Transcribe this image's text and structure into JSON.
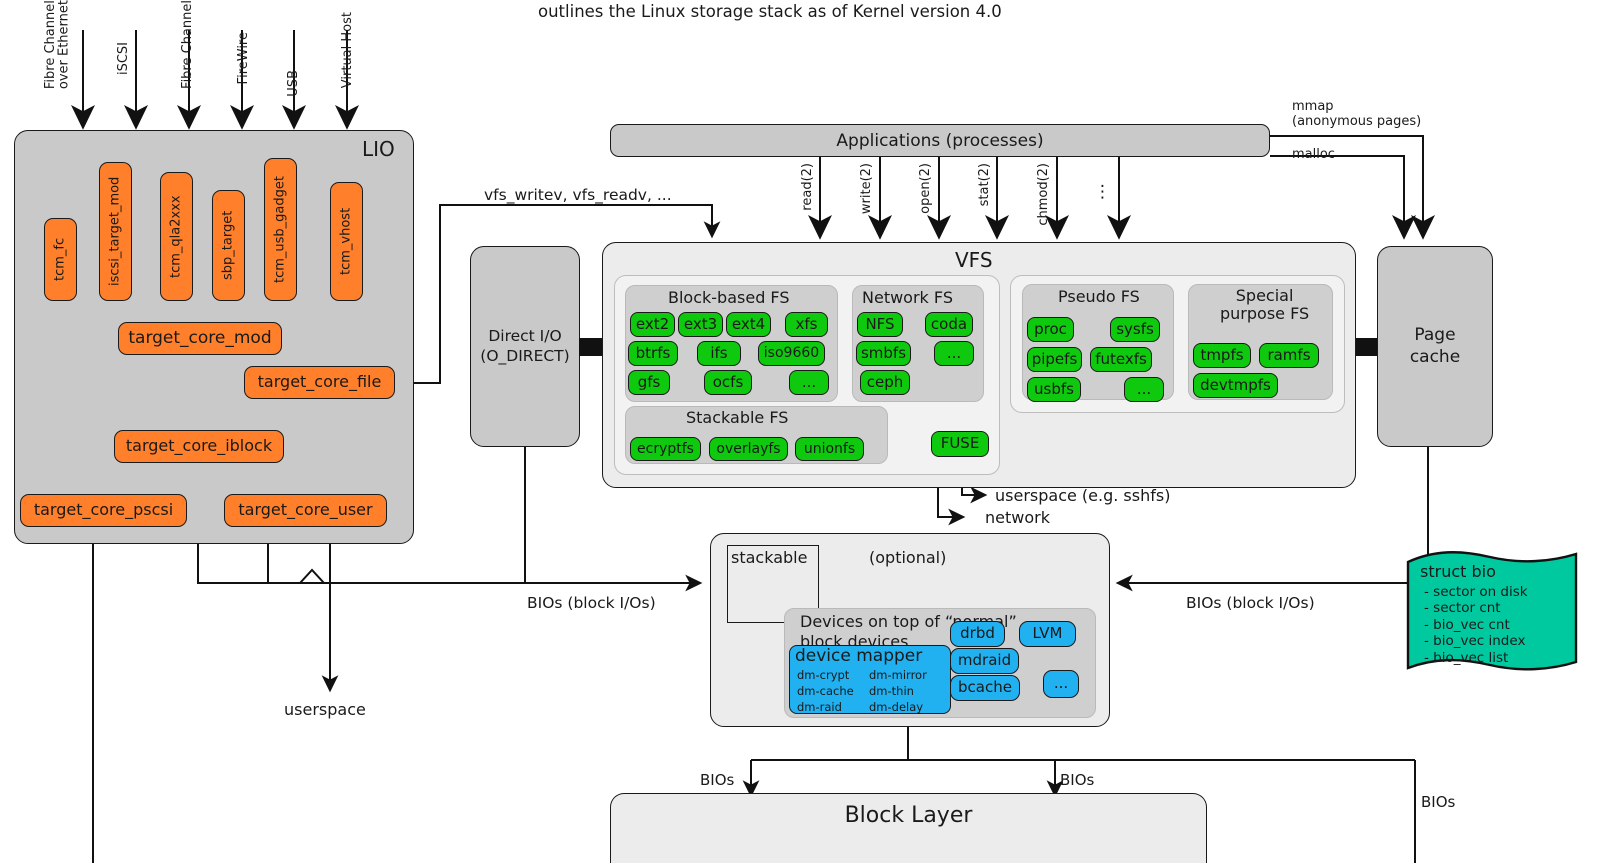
{
  "header": {
    "subtitle": "outlines the Linux storage stack as of Kernel version 4.0"
  },
  "lio": {
    "title": "LIO",
    "transports": [
      {
        "label": "Fibre Channel\nover Ethernet"
      },
      {
        "label": "iSCSI"
      },
      {
        "label": "Fibre Channel"
      },
      {
        "label": "FireWire"
      },
      {
        "label": "USB"
      },
      {
        "label": "Virtual Host"
      }
    ],
    "frontend_modules": [
      {
        "label": "tcm_fc"
      },
      {
        "label": "iscsi_target_mod"
      },
      {
        "label": "tcm_qla2xxx"
      },
      {
        "label": "sbp_target"
      },
      {
        "label": "tcm_usb_gadget"
      },
      {
        "label": "tcm_vhost"
      }
    ],
    "core": {
      "label": "target_core_mod"
    },
    "backends": [
      {
        "label": "target_core_file"
      },
      {
        "label": "target_core_iblock"
      },
      {
        "label": "target_core_pscsi"
      },
      {
        "label": "target_core_user"
      }
    ]
  },
  "applications": {
    "label": "Applications (processes)",
    "syscalls": [
      "read(2)",
      "write(2)",
      "open(2)",
      "stat(2)",
      "chmod(2)",
      "⋮"
    ],
    "mmap_label": "mmap\n(anonymous pages)",
    "malloc_label": "malloc"
  },
  "direct_io": {
    "label": "Direct I/O\n(O_DIRECT)"
  },
  "vfs": {
    "title": "VFS",
    "vfs_calls_label": "vfs_writev, vfs_readv, ...",
    "groups": [
      {
        "name": "block-based-fs",
        "title": "Block-based FS",
        "items": [
          "ext2",
          "ext3",
          "ext4",
          "xfs",
          "btrfs",
          "ifs",
          "iso9660",
          "gfs",
          "ocfs",
          "..."
        ]
      },
      {
        "name": "network-fs",
        "title": "Network FS",
        "items": [
          "NFS",
          "coda",
          "smbfs",
          "...",
          "ceph"
        ]
      },
      {
        "name": "stackable-fs",
        "title": "Stackable FS",
        "items": [
          "ecryptfs",
          "overlayfs",
          "unionfs"
        ]
      },
      {
        "name": "pseudo-fs",
        "title": "Pseudo FS",
        "items": [
          "proc",
          "sysfs",
          "pipefs",
          "futexfs",
          "usbfs",
          "..."
        ]
      },
      {
        "name": "special-purpose-fs",
        "title": "Special\npurpose FS",
        "items": [
          "tmpfs",
          "ramfs",
          "devtmpfs"
        ]
      }
    ],
    "fuse": {
      "label": "FUSE"
    },
    "userspace_arrow_label": "userspace (e.g. sshfs)",
    "network_arrow_label": "network"
  },
  "page_cache": {
    "label": "Page\ncache"
  },
  "struct_bio": {
    "title": "struct bio",
    "fields": [
      "- sector on disk",
      "- sector cnt",
      "- bio_vec cnt",
      "- bio_vec index",
      "- bio_vec list"
    ]
  },
  "stackable_devices": {
    "stackable_label": "stackable",
    "optional_label": "(optional)",
    "title": "Devices on top of “normal”\nblock devices",
    "device_mapper": {
      "title": "device mapper",
      "targets": [
        "dm-crypt",
        "dm-mirror",
        "dm-cache",
        "dm-thin",
        "dm-raid",
        "dm-delay"
      ]
    },
    "others": [
      "drbd",
      "LVM",
      "mdraid",
      "bcache",
      "..."
    ]
  },
  "block_layer": {
    "label": "Block Layer"
  },
  "edge_labels": {
    "bios_block_ios_left": "BIOs (block I/Os)",
    "bios_block_ios_right": "BIOs (block I/Os)",
    "userspace": "userspace",
    "bios_left": "BIOs",
    "bios_mid": "BIOs",
    "bios_right": "BIOs"
  },
  "colors": {
    "orange": "#ff7f2a",
    "green": "#0ec90e",
    "blue": "#21b0f0",
    "teal": "#00c9a0",
    "grey_box": "#c9c9c9",
    "grey_light": "#ececec",
    "stroke": "#1a1a1a"
  }
}
